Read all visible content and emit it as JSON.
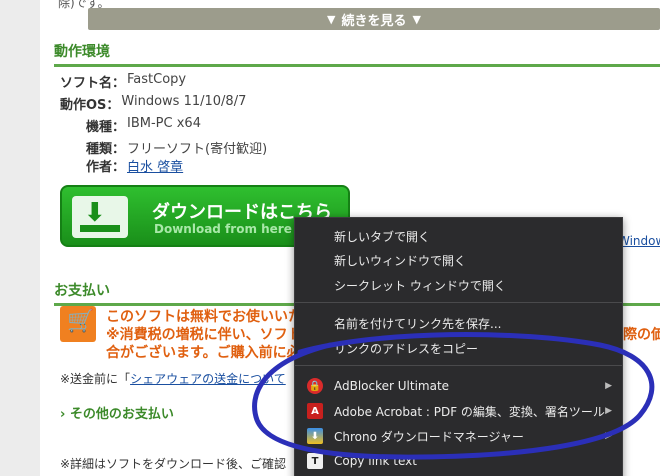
{
  "page": {
    "top_snippet": "除)です。",
    "continue_label": "続きを見る",
    "env_heading": "動作環境",
    "specs": [
      {
        "key": "ソフト名：",
        "value": "FastCopy",
        "link": false
      },
      {
        "key": "動作OS：",
        "value": "Windows 11/10/8/7",
        "link": false
      },
      {
        "key": "機種：",
        "value": "IBM-PC x64",
        "link": false
      },
      {
        "key": "種類：",
        "value": "フリーソフト(寄付歓迎)",
        "link": false
      },
      {
        "key": "作者：",
        "value": "白水 啓章",
        "link": true
      }
    ],
    "download": {
      "main": "ダウンロードはこちら",
      "sub": "Download from here"
    },
    "window_text": "Window",
    "pay_heading": "お支払い",
    "pay_lines": [
      "このソフトは無料でお使いいた",
      "※消費税の増税に伴い、ソフト",
      "合がございます。ご購入前に必"
    ],
    "pay_right": "際の価",
    "note1_prefix": "※送金前に「",
    "note1_link": "シェアウェアの送金について",
    "other_pay": "その他のお支払い",
    "note2": "※詳細はソフトをダウンロード後、ご確認"
  },
  "context_menu": {
    "items": [
      {
        "label": "新しいタブで開く"
      },
      {
        "label": "新しいウィンドウで開く"
      },
      {
        "label": "シークレット ウィンドウで開く"
      },
      {
        "label": "名前を付けてリンク先を保存..."
      },
      {
        "label": "リンクのアドレスをコピー"
      },
      {
        "label": "AdBlocker Ultimate",
        "icon": "adblocker-icon"
      },
      {
        "label": "Adobe Acrobat : PDF の編集、変換、署名ツール",
        "icon": "acrobat-icon"
      },
      {
        "label": "Chrono ダウンロードマネージャー",
        "icon": "chrono-icon"
      },
      {
        "label": "Copy link text",
        "icon": "copy-text-icon"
      }
    ]
  },
  "colors": {
    "menu_bg": "#2b2b2d",
    "annotation": "#2b2fb8",
    "accent_green": "#3c8a2a",
    "accent_orange": "#e06010"
  }
}
